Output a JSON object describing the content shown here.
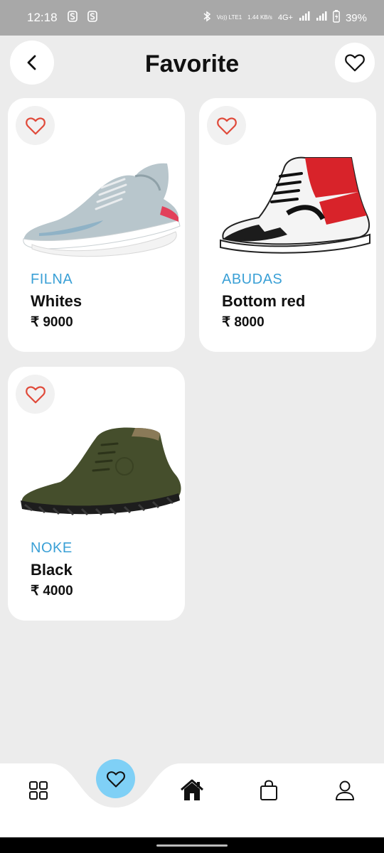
{
  "status_bar": {
    "time": "12:18",
    "notif_icons": [
      "s-icon",
      "s-icon"
    ],
    "volte": "Vo)) LTE1",
    "net_speed": "1.44 KB/s",
    "network": "4G+",
    "battery": "39%"
  },
  "header": {
    "title": "Favorite"
  },
  "products": [
    {
      "brand": "FILNA",
      "name": "Whites",
      "price": "₹ 9000",
      "shoe": "grey-running-sneaker"
    },
    {
      "brand": "ABUDAS",
      "name": "Bottom red",
      "price": "₹ 8000",
      "shoe": "red-black-high-top"
    },
    {
      "brand": "NOKE",
      "name": "Black",
      "price": "₹ 4000",
      "shoe": "olive-suede-boot"
    }
  ],
  "bottom_nav": {
    "items": [
      "grid-icon",
      "heart-icon",
      "home-icon",
      "bag-icon",
      "profile-icon"
    ],
    "active": "heart-icon"
  },
  "colors": {
    "accent_blue": "#3aa0d6",
    "heart_red": "#e04a3a",
    "active_nav_bg": "#7fd0f6",
    "background": "#ececec"
  }
}
